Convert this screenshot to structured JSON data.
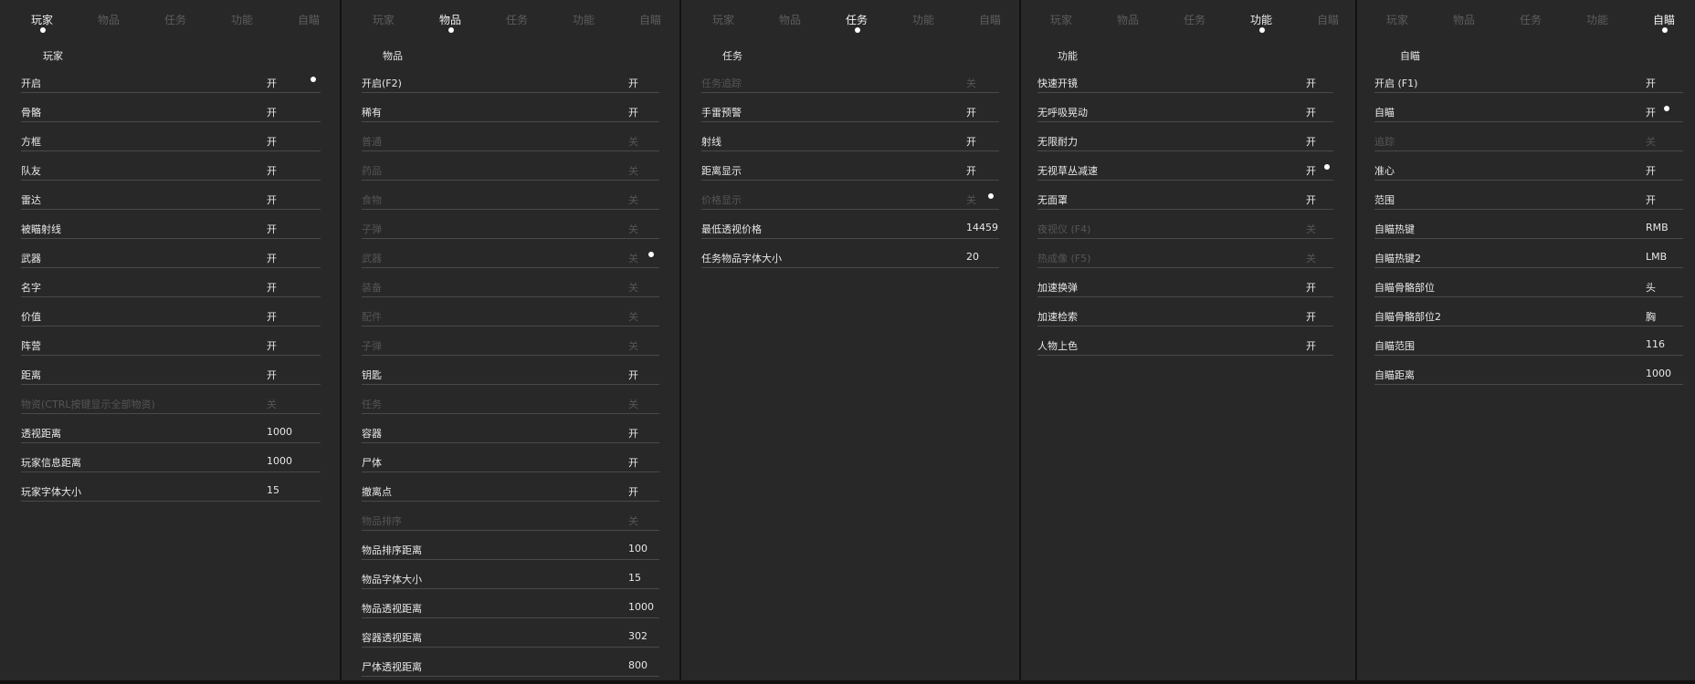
{
  "tabs": [
    "玩家",
    "物品",
    "任务",
    "功能",
    "自瞄"
  ],
  "colors": {
    "panel_bg": "#282828",
    "text": "#e8e8e8",
    "disabled_text": "#555555",
    "row_divider": "#4a4a4a",
    "indicator": "#ffffff"
  },
  "panels": [
    {
      "active_tab": 0,
      "title": "玩家",
      "rows": [
        {
          "label": "开启",
          "value": "开",
          "enabled": true,
          "indicator": true
        },
        {
          "label": "骨骼",
          "value": "开",
          "enabled": true
        },
        {
          "label": "方框",
          "value": "开",
          "enabled": true
        },
        {
          "label": "队友",
          "value": "开",
          "enabled": true
        },
        {
          "label": "雷达",
          "value": "开",
          "enabled": true
        },
        {
          "label": "被瞄射线",
          "value": "开",
          "enabled": true
        },
        {
          "label": "武器",
          "value": "开",
          "enabled": true
        },
        {
          "label": "名字",
          "value": "开",
          "enabled": true
        },
        {
          "label": "价值",
          "value": "开",
          "enabled": true
        },
        {
          "label": "阵营",
          "value": "开",
          "enabled": true
        },
        {
          "label": "距离",
          "value": "开",
          "enabled": true
        },
        {
          "label": "物资(CTRL按键显示全部物资)",
          "value": "关",
          "enabled": false
        },
        {
          "label": "透视距离",
          "value": "1000",
          "enabled": true
        },
        {
          "label": "玩家信息距离",
          "value": "1000",
          "enabled": true
        },
        {
          "label": "玩家字体大小",
          "value": "15",
          "enabled": true
        }
      ]
    },
    {
      "active_tab": 1,
      "title": "物品",
      "rows": [
        {
          "label": "开启(F2)",
          "value": "开",
          "enabled": true
        },
        {
          "label": "稀有",
          "value": "开",
          "enabled": true
        },
        {
          "label": "普通",
          "value": "关",
          "enabled": false
        },
        {
          "label": "药品",
          "value": "关",
          "enabled": false
        },
        {
          "label": "食物",
          "value": "关",
          "enabled": false
        },
        {
          "label": "子弹",
          "value": "关",
          "enabled": false
        },
        {
          "label": "武器",
          "value": "关",
          "enabled": false,
          "indicator": true
        },
        {
          "label": "装备",
          "value": "关",
          "enabled": false
        },
        {
          "label": "配件",
          "value": "关",
          "enabled": false
        },
        {
          "label": "子弹",
          "value": "关",
          "enabled": false
        },
        {
          "label": "钥匙",
          "value": "开",
          "enabled": true
        },
        {
          "label": "任务",
          "value": "关",
          "enabled": false
        },
        {
          "label": "容器",
          "value": "开",
          "enabled": true
        },
        {
          "label": "尸体",
          "value": "开",
          "enabled": true
        },
        {
          "label": "撤离点",
          "value": "开",
          "enabled": true
        },
        {
          "label": "物品排序",
          "value": "关",
          "enabled": false
        },
        {
          "label": "物品排序距离",
          "value": "100",
          "enabled": true
        },
        {
          "label": "物品字体大小",
          "value": "15",
          "enabled": true
        },
        {
          "label": "物品透视距离",
          "value": "1000",
          "enabled": true
        },
        {
          "label": "容器透视距离",
          "value": "302",
          "enabled": true
        },
        {
          "label": "尸体透视距离",
          "value": "800",
          "enabled": true
        }
      ]
    },
    {
      "active_tab": 2,
      "title": "任务",
      "rows": [
        {
          "label": "任务追踪",
          "value": "关",
          "enabled": false
        },
        {
          "label": "手雷预警",
          "value": "开",
          "enabled": true
        },
        {
          "label": "射线",
          "value": "开",
          "enabled": true
        },
        {
          "label": "距离显示",
          "value": "开",
          "enabled": true
        },
        {
          "label": "价格显示",
          "value": "关",
          "enabled": false,
          "indicator": true
        },
        {
          "label": "最低透视价格",
          "value": "14459",
          "enabled": true
        },
        {
          "label": "任务物品字体大小",
          "value": "20",
          "enabled": true
        }
      ]
    },
    {
      "active_tab": 3,
      "title": "功能",
      "rows": [
        {
          "label": "快速开镜",
          "value": "开",
          "enabled": true
        },
        {
          "label": "无呼吸晃动",
          "value": "开",
          "enabled": true
        },
        {
          "label": "无限耐力",
          "value": "开",
          "enabled": true
        },
        {
          "label": "无视草丛减速",
          "value": "开",
          "enabled": true,
          "indicator": true
        },
        {
          "label": "无面罩",
          "value": "开",
          "enabled": true
        },
        {
          "label": "夜视仪 (F4)",
          "value": "关",
          "enabled": false
        },
        {
          "label": "热成像 (F5)",
          "value": "关",
          "enabled": false
        },
        {
          "label": "加速换弹",
          "value": "开",
          "enabled": true
        },
        {
          "label": "加速检索",
          "value": "开",
          "enabled": true
        },
        {
          "label": "人物上色",
          "value": "开",
          "enabled": true
        }
      ]
    },
    {
      "active_tab": 4,
      "title": "自瞄",
      "rows": [
        {
          "label": "开启 (F1)",
          "value": "开",
          "enabled": true
        },
        {
          "label": "自瞄",
          "value": "开",
          "enabled": true,
          "indicator": true
        },
        {
          "label": "追踪",
          "value": "关",
          "enabled": false
        },
        {
          "label": "准心",
          "value": "开",
          "enabled": true
        },
        {
          "label": "范围",
          "value": "开",
          "enabled": true
        },
        {
          "label": "自瞄热键",
          "value": "RMB",
          "enabled": true
        },
        {
          "label": "自瞄热键2",
          "value": "LMB",
          "enabled": true
        },
        {
          "label": "自瞄骨骼部位",
          "value": "头",
          "enabled": true
        },
        {
          "label": "自瞄骨骼部位2",
          "value": "胸",
          "enabled": true
        },
        {
          "label": "自瞄范围",
          "value": "116",
          "enabled": true
        },
        {
          "label": "自瞄距离",
          "value": "1000",
          "enabled": true
        }
      ]
    }
  ]
}
